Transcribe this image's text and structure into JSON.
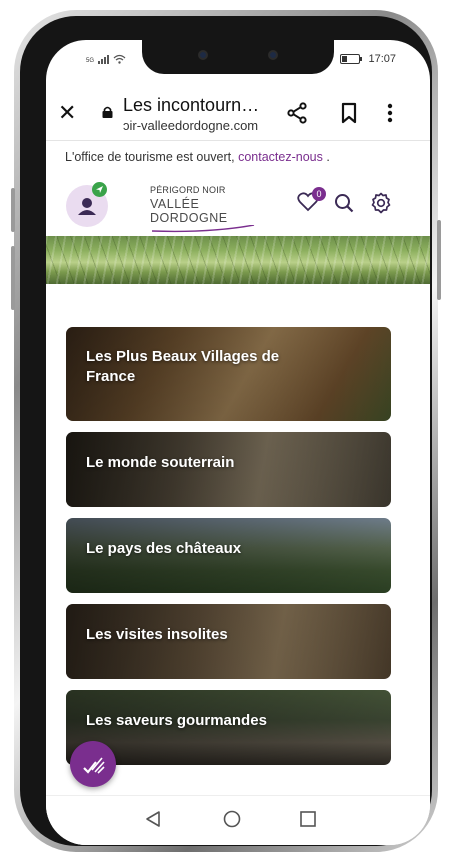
{
  "status_bar": {
    "network": "5G",
    "time": "17:07"
  },
  "browser": {
    "page_title": "Les incontourn…",
    "url": "ɔir-valleedordogne.com"
  },
  "notice": {
    "text": "L'office de tourisme est ouvert, ",
    "link": "contactez-nous"
  },
  "site_header": {
    "logo_top": "PÉRIGORD NOIR",
    "logo_bottom": "VALLÉE DORDOGNE",
    "favorites_count": "0"
  },
  "cards": [
    {
      "label": "Les Plus Beaux Villages de France"
    },
    {
      "label": "Le monde souterrain"
    },
    {
      "label": "Le pays des châteaux"
    },
    {
      "label": "Les visites insolites"
    },
    {
      "label": "Les saveurs gourmandes"
    }
  ],
  "colors": {
    "brand": "#7a2e8e",
    "badge_green": "#3aa34a"
  }
}
